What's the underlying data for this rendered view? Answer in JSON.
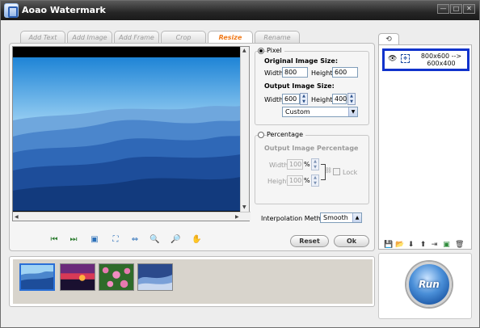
{
  "window": {
    "title": "Aoao Watermark",
    "controls": [
      "—",
      "□",
      "✕"
    ]
  },
  "tabs": [
    {
      "label": "Add Text",
      "active": false
    },
    {
      "label": "Add Image",
      "active": false
    },
    {
      "label": "Add Frame",
      "active": false
    },
    {
      "label": "Crop",
      "active": false
    },
    {
      "label": "Resize",
      "active": true
    },
    {
      "label": "Rename",
      "active": false
    }
  ],
  "resize": {
    "pixel_label": "Pixel",
    "original_size_label": "Original Image Size:",
    "orig_width_label": "Width:",
    "orig_width": "800",
    "orig_height_label": "Height:",
    "orig_height": "600",
    "output_size_label": "Output Image Size:",
    "out_width_label": "Width:",
    "out_width": "600",
    "out_height_label": "Height:",
    "out_height": "400",
    "preset_value": "Custom",
    "percentage_label": "Percentage",
    "output_percentage_label": "Output Image Percentage",
    "pct_width_label": "Width:",
    "pct_width": "100",
    "pct_height_label": "Height:",
    "pct_height": "100",
    "pct_unit": "%",
    "lock_label": "Lock",
    "interpolation_label": "Interpolation Methods:",
    "interpolation_value": "Smooth",
    "reset_label": "Reset",
    "ok_label": "Ok"
  },
  "file_list": {
    "item_text_line1": "800x600 -->",
    "item_text_line2": "600x400"
  },
  "run_label": "Run",
  "colors": {
    "accent_tab": "#f07a1a",
    "selection_border": "#1133cc",
    "run_button": "#4a8fd8"
  }
}
